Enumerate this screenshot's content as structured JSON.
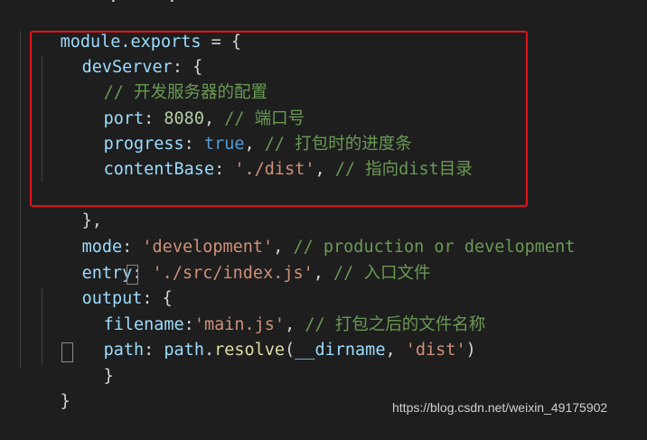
{
  "code": {
    "top_cut": ". \"\"' .",
    "l1": {
      "a": "module.exports",
      "b": " = {"
    },
    "l2": {
      "a": "devServer",
      "b": ": {"
    },
    "l3": {
      "a": "// 开发服务器的配置"
    },
    "l4": {
      "a": "port",
      "b": ": ",
      "c": "8080",
      "d": ", ",
      "e": "// 端口号"
    },
    "l5": {
      "a": "progress",
      "b": ": ",
      "c": "true",
      "d": ", ",
      "e": "// 打包时的进度条"
    },
    "l6": {
      "a": "contentBase",
      "b": ": ",
      "c": "'./dist'",
      "d": ", ",
      "e": "// 指向dist目录"
    },
    "l8": {
      "a": "},"
    },
    "l9": {
      "a": "mode",
      "b": ": ",
      "c": "'development'",
      "d": ", ",
      "e": "// production or development"
    },
    "l10": {
      "a": "entry",
      "b": ": ",
      "c": "'./src/index.js'",
      "d": ", ",
      "e": "// 入口文件"
    },
    "l11": {
      "a": "output",
      "b": ": ",
      "c": "{"
    },
    "l12": {
      "a": "filename",
      "b": ":",
      "c": "'main.js'",
      "d": ", ",
      "e": "// 打包之后的文件名称"
    },
    "l13": {
      "a": "path",
      "b": ": ",
      "c": "path",
      "d": ".",
      "e": "resolve",
      "f": "(",
      "g": "__dirname",
      "h": ", ",
      "i": "'dist'",
      "j": ")"
    },
    "l14": {
      "a": "}"
    },
    "l15": {
      "a": "}"
    }
  },
  "watermark": "https://blog.csdn.net/weixin_49175902",
  "colors": {
    "background": "#1e1e1e",
    "variable": "#9cdcfe",
    "number": "#b5cea8",
    "keyword": "#569cd6",
    "string": "#ce9178",
    "comment": "#6a9955",
    "function": "#dcdcaa",
    "highlight_box": "#e5101b"
  }
}
